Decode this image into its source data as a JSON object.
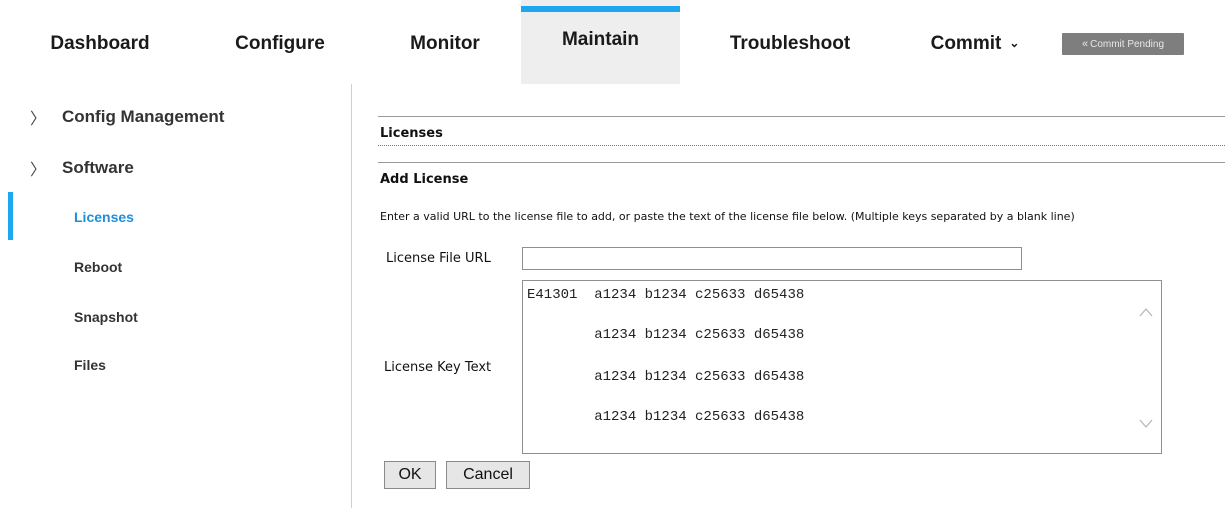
{
  "nav": {
    "items": [
      {
        "label": "Dashboard"
      },
      {
        "label": "Configure"
      },
      {
        "label": "Monitor"
      },
      {
        "label": "Maintain"
      },
      {
        "label": "Troubleshoot"
      },
      {
        "label": "Commit"
      }
    ],
    "active": "Maintain",
    "commit_caret": "⌄",
    "pending_label": "Commit Pending",
    "pending_icon": "«"
  },
  "sidebar": {
    "groups": [
      {
        "label": "Config Management",
        "icon": "chevron-right-icon"
      },
      {
        "label": "Software",
        "icon": "chevron-right-icon"
      }
    ],
    "items": [
      {
        "label": "Licenses"
      },
      {
        "label": "Reboot"
      },
      {
        "label": "Snapshot"
      },
      {
        "label": "Files"
      }
    ],
    "active_item": "Licenses"
  },
  "main": {
    "section_title": "Licenses",
    "subsection_title": "Add License",
    "instruction": "Enter a valid URL to the license file to add, or paste the text of the license file below. (Multiple keys separated by a blank line)",
    "license_url_label": "License File URL",
    "license_url_value": "",
    "license_key_label": "License Key Text",
    "license_key_lines": [
      "E41301  a1234 b1234 c25633 d65438",
      "        a1234 b1234 c25633 d65438",
      "        a1234 b1234 c25633 d65438",
      "        a1234 b1234 c25633 d65438"
    ],
    "ok_label": "OK",
    "cancel_label": "Cancel"
  },
  "colors": {
    "accent": "#1ea7f0",
    "active_link": "#1e8fd9",
    "pending_bg": "#7e7e7e"
  }
}
